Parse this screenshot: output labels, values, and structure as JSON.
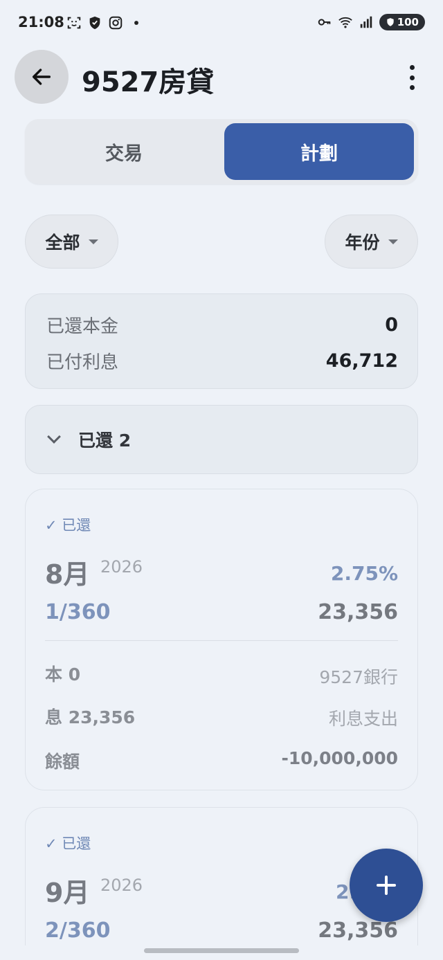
{
  "status_bar": {
    "time": "21:08",
    "battery": "100"
  },
  "app_bar": {
    "title": "9527房貸"
  },
  "tabs": [
    {
      "label": "交易",
      "selected": false
    },
    {
      "label": "計劃",
      "selected": true
    }
  ],
  "filters": {
    "category": "全部",
    "period": "年份"
  },
  "summary": {
    "principal_label": "已還本金",
    "principal_value": "0",
    "interest_label": "已付利息",
    "interest_value": "46,712"
  },
  "paid_section": {
    "label": "已還 2",
    "expanded": true
  },
  "cards": [
    {
      "status": "✓ 已還",
      "month": "8月",
      "year": "2026",
      "rate": "2.75%",
      "period": "1/360",
      "amount": "23,356",
      "principal": "本 0",
      "account": "9527銀行",
      "interest": "息 23,356",
      "category": "利息支出",
      "balance_label": "餘額",
      "balance": "-10,000,000"
    },
    {
      "status": "✓ 已還",
      "month": "9月",
      "year": "2026",
      "rate": "2.",
      "period": "2/360",
      "amount": "23,356"
    }
  ],
  "colors": {
    "accent": "#3a5ea8",
    "fab": "#2e4f94",
    "background": "#eef2f8"
  },
  "icons": {
    "back": "arrow-left-icon",
    "more": "more-vert-icon",
    "fab": "plus-icon",
    "section": "chevron-down-icon"
  }
}
